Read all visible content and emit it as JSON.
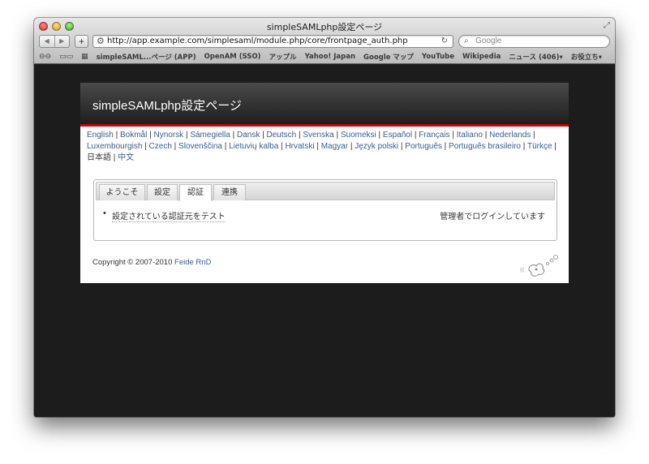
{
  "window": {
    "title": "simpleSAMLphp設定ページ"
  },
  "toolbar": {
    "back_icon": "◀",
    "forward_icon": "▶",
    "add_label": "+",
    "url": "http://app.example.com/simplesaml/module.php/core/frontpage_auth.php",
    "reload_icon": "↻",
    "search_placeholder": "Google"
  },
  "bookmarks": {
    "items": [
      "simpleSAML...ページ (APP)",
      "OpenAM (SSO)",
      "アップル",
      "Yahoo! Japan",
      "Google マップ",
      "YouTube",
      "Wikipedia",
      "ニュース (406)▾",
      "お役立ち▾"
    ]
  },
  "page": {
    "header_title": "simpleSAMLphp設定ページ",
    "languages": [
      "English",
      "Bokmål",
      "Nynorsk",
      "Sámegiella",
      "Dansk",
      "Deutsch",
      "Svenska",
      "Suomeksi",
      "Español",
      "Français",
      "Italiano",
      "Nederlands",
      "Luxembourgish",
      "Czech",
      "Slovenščina",
      "Lietuvių kalba",
      "Hrvatski",
      "Magyar",
      "Język polski",
      "Português",
      "Português brasileiro",
      "Türkçe",
      "日本語",
      "中文"
    ],
    "tabs": [
      "ようこそ",
      "設定",
      "認証",
      "連携"
    ],
    "active_tab": "認証",
    "link_test_auth": "設定されている認証元をテスト",
    "logged_in_status": "管理者でログインしています",
    "copyright_prefix": "Copyright © 2007-2010 ",
    "copyright_link": "Feide RnD"
  },
  "colors": {
    "header_bar": "#1e1e1e",
    "accent_red": "#d60000",
    "link": "#3a5d8a",
    "browser_background": "#1c1c1c"
  }
}
